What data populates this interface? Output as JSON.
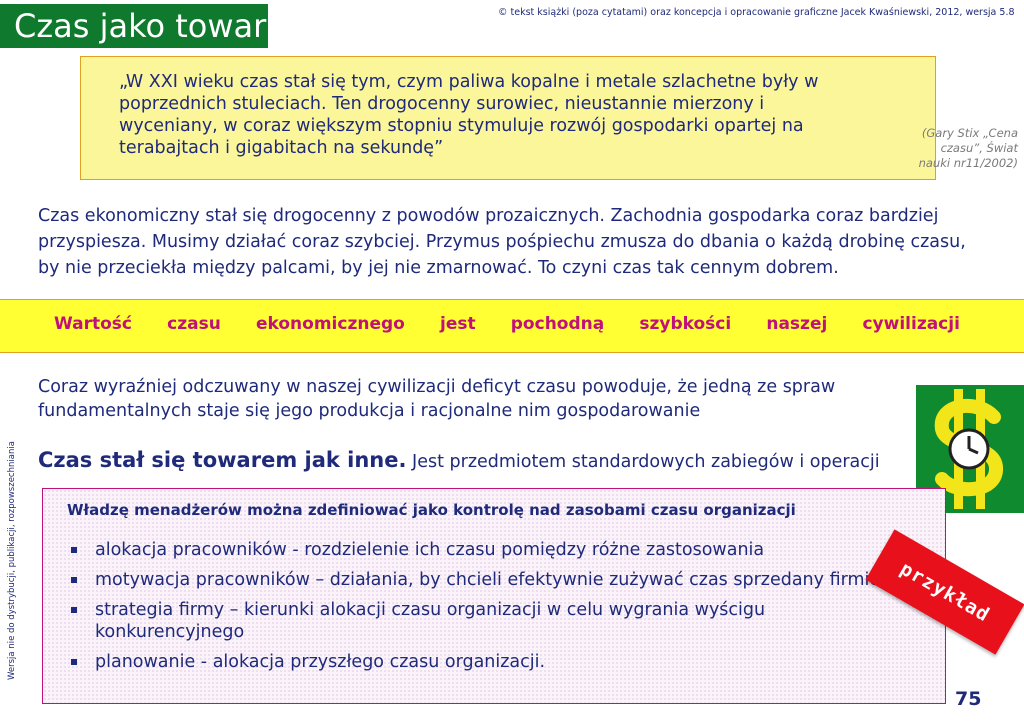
{
  "title": "Czas jako towar",
  "copyright": "© tekst książki (poza cytatami) oraz koncepcja i opracowanie graficzne Jacek Kwaśniewski, 2012,  wersja 5.8",
  "quote": {
    "text": "„W XXI wieku czas stał się tym, czym paliwa kopalne i metale szlachetne były w poprzednich stuleciach. Ten drogocenny surowiec, nieustannie mierzony i wyceniany, w coraz większym stopniu stymuluje rozwój gospodarki opartej na terabajtach i gigabitach na sekundę”",
    "citation_lines": [
      "(Gary Stix „Cena",
      "czasu”, Świat",
      "nauki  nr11/2002)"
    ]
  },
  "paragraph1": "Czas ekonomiczny stał się drogocenny z powodów prozaicznych. Zachodnia gospodarka coraz bardziej przyspiesza. Musimy działać coraz szybciej. Przymus pośpiechu zmusza do dbania o każdą drobinę czasu, by nie przeciekła między palcami, by jej nie zmarnować. To czyni czas tak cennym dobrem.",
  "banner_words": [
    "Wartość",
    "czasu",
    "ekonomicznego",
    "jest",
    "pochodną",
    "szybkości",
    "naszej",
    "cywilizacji"
  ],
  "paragraph2": "Coraz wyraźniej odczuwany w naszej cywilizacji deficyt czasu powoduje, że jedną ze spraw fundamentalnych staje się jego produkcja i racjonalne nim gospodarowanie",
  "bold_line": {
    "strong": "Czas stał się towarem jak inne.",
    "rest": " Jest przedmiotem standardowych zabiegów i operacji"
  },
  "manager_box": {
    "title": "Władzę menadżerów można zdefiniować jako kontrolę nad zasobami czasu organizacji",
    "bullets": [
      "alokacja pracowników - rozdzielenie ich czasu pomiędzy różne zastosowania",
      "motywacja pracowników – działania, by chcieli efektywnie zużywać czas sprzedany firmie",
      "strategia firmy – kierunki alokacji czasu organizacji w celu wygrania wyścigu konkurencyjnego",
      "planowanie - alokacja przyszłego czasu organizacji."
    ]
  },
  "example_tag": "przykład",
  "side_text": "Wersja nie do dystrybucji, publikacji, rozpowszechniania",
  "page_number": "75",
  "colors": {
    "title_bg": "#0f7a2e",
    "text": "#1f2a7a",
    "banner_bg": "#ffff33",
    "banner_text": "#c0107a",
    "quote_bg": "#fbf69a",
    "example_bg": "#e8101a",
    "icon_green": "#0f8a2e",
    "icon_yellow": "#f2e61a"
  },
  "icons": {
    "money_time": "dollar-clock-icon"
  }
}
